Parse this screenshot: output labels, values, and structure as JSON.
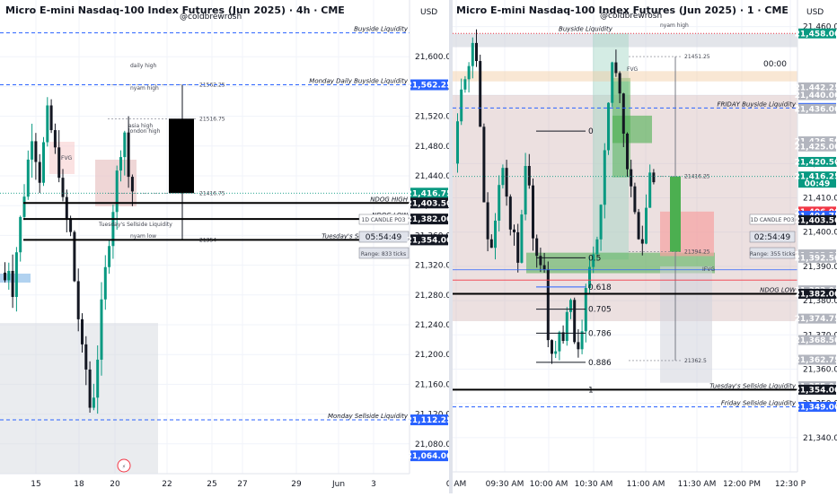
{
  "watermark": "@coldbrewrosh",
  "chart_data": [
    {
      "type": "candlestick",
      "title": "Micro E-mini Nasdaq-100 Index Futures (Jun 2025) · 4h · CME",
      "currency_label": "USD",
      "ylim": [
        21040,
        21640
      ],
      "y_ticks": [
        21600,
        21560,
        21520,
        21480,
        21440,
        21400,
        21360,
        21320,
        21280,
        21240,
        21200,
        21160,
        21120,
        21080
      ],
      "y_tick_labels": [
        "21,600.00",
        "21,560.00",
        "21,520.00",
        "21,480.00",
        "21,440.00",
        "21,400.00",
        "21,360.00",
        "21,320.00",
        "21,280.00",
        "21,240.00",
        "21,200.00",
        "21,160.00",
        "21,120.00",
        "21,080.00"
      ],
      "x_ticks": [
        "15",
        "18",
        "20",
        "22",
        "25",
        "27",
        "29",
        "Jun",
        "3"
      ],
      "price_tags": [
        {
          "value": 21562.25,
          "label": "21,562.25",
          "color": "#2962ff"
        },
        {
          "value": 21416.75,
          "label": "21,416.75",
          "sub": "02:54:49",
          "color": "#089981"
        },
        {
          "value": 21403.5,
          "label": "21,403.50",
          "color": "#131722"
        },
        {
          "value": 21382.0,
          "label": "21,382.00",
          "color": "#131722"
        },
        {
          "value": 21354.0,
          "label": "21,354.00",
          "color": "#131722"
        },
        {
          "value": 21112.25,
          "label": "21,112.25",
          "color": "#2962ff"
        },
        {
          "value": 21064.0,
          "label": "21,064.00",
          "color": "#2962ff"
        }
      ],
      "levels": [
        {
          "value": 21632,
          "label": "Buyside Liquidity",
          "style": "dashed",
          "color": "#2962ff"
        },
        {
          "value": 21562.25,
          "label": "Monday Daily Buyside Liquidity",
          "style": "dashed",
          "color": "#2962ff"
        },
        {
          "value": 21403.5,
          "label": "NDOG HIGH",
          "style": "solid",
          "color": "#000000"
        },
        {
          "value": 21382.0,
          "label": "NDOG LOW",
          "style": "solid",
          "color": "#000000"
        },
        {
          "value": 21354.0,
          "label": "Tuesday's Sellside Liquidity",
          "style": "solid",
          "color": "#000000"
        },
        {
          "value": 21112.25,
          "label": "Monday Sellside Liquidity",
          "style": "dashed",
          "color": "#2962ff"
        }
      ],
      "annotations": {
        "candle_box_title": "1D CANDLE PO3",
        "candle_box_timer": "05:54:49",
        "candle_box_range": "Range: 833 ticks",
        "po3_levels": [
          "21562.25",
          "21516.75",
          "21416.75",
          "21354"
        ],
        "small_labels": [
          "daily high",
          "nyam high",
          "asia high",
          "london high",
          "Tuesday's Sellside Liquidity",
          "nyam low",
          "FVG"
        ]
      }
    },
    {
      "type": "candlestick",
      "title": "Micro E-mini Nasdaq-100 Index Futures (Jun 2025) · 1 · CME",
      "currency_label": "USD",
      "ylim": [
        21330,
        21462
      ],
      "y_ticks": [
        21460,
        21440,
        21420,
        21410,
        21400,
        21390,
        21380,
        21370,
        21360,
        21350,
        21340
      ],
      "x_ticks": [
        "0 AM",
        "09:30 AM",
        "10:00 AM",
        "10:30 AM",
        "11:00 AM",
        "11:30 AM",
        "12:00 PM",
        "12:30 P"
      ],
      "price_tags": [
        {
          "value": 21458.0,
          "label": "21,458.00",
          "color": "#089981"
        },
        {
          "value": 21442.25,
          "label": "21,442.25",
          "color": "#b2b5be"
        },
        {
          "value": 21440.0,
          "label": "21,440.00",
          "color": "#b2b5be"
        },
        {
          "value": 21436.25,
          "label": "21,436.25",
          "color": "#2962ff"
        },
        {
          "value": 21436.0,
          "label": "21,436.00",
          "color": "#b2b5be"
        },
        {
          "value": 21426.5,
          "label": "21,426.50",
          "color": "#b2b5be"
        },
        {
          "value": 21425.0,
          "label": "21,425.00",
          "color": "#b2b5be"
        },
        {
          "value": 21420.5,
          "label": "21,420.50",
          "color": "#089981"
        },
        {
          "value": 21416.25,
          "label": "21,416.25",
          "sub": "00:49",
          "color": "#089981"
        },
        {
          "value": 21406.0,
          "label": "21,406.00",
          "color": "#f23645"
        },
        {
          "value": 21404.75,
          "label": "21,404.75",
          "color": "#2962ff"
        },
        {
          "value": 21403.5,
          "label": "21,403.50",
          "color": "#131722"
        },
        {
          "value": 21393.5,
          "label": "21,393.50",
          "color": "#b2b5be"
        },
        {
          "value": 21393.25,
          "label": "21,393.25",
          "color": "#b2b5be"
        },
        {
          "value": 21392.5,
          "label": "21,392.50",
          "color": "#b2b5be"
        },
        {
          "value": 21383.0,
          "label": "21,383.00",
          "color": "#b2b5be"
        },
        {
          "value": 21382.0,
          "label": "21,382.00",
          "color": "#131722"
        },
        {
          "value": 21374.75,
          "label": "21,374.75",
          "color": "#b2b5be"
        },
        {
          "value": 21368.5,
          "label": "21,368.50",
          "color": "#b2b5be"
        },
        {
          "value": 21362.75,
          "label": "21,362.75",
          "color": "#b2b5be"
        },
        {
          "value": 21355.0,
          "label": "21,355.00",
          "color": "#b2b5be"
        },
        {
          "value": 21354.0,
          "label": "21,354.00",
          "color": "#131722"
        },
        {
          "value": 21349.0,
          "label": "21,349.00",
          "color": "#2962ff"
        }
      ],
      "levels": [
        {
          "value": 21458,
          "label": "Buyside Liquidity",
          "style": "dotted",
          "color": "#f23645"
        },
        {
          "value": 21436.25,
          "label": "FRIDAY Buyside Liquidity",
          "style": "dashed",
          "color": "#2962ff"
        },
        {
          "value": 21382.0,
          "label": "NDOG LOW",
          "style": "solid",
          "color": "#000000"
        },
        {
          "value": 21354.0,
          "label": "Tuesday's Sellside Liquidity",
          "style": "solid",
          "color": "#000000"
        },
        {
          "value": 21349.0,
          "label": "Friday Sellside Liquidity",
          "style": "dashed",
          "color": "#2962ff"
        }
      ],
      "fib_levels": [
        {
          "value": 21429.5,
          "label": "0"
        },
        {
          "value": 21392.5,
          "label": "0.5"
        },
        {
          "value": 21384.0,
          "label": "0.618"
        },
        {
          "value": 21377.5,
          "label": "0.705"
        },
        {
          "value": 21370.5,
          "label": "0.786"
        },
        {
          "value": 21362.0,
          "label": "0.886"
        },
        {
          "value": 21354.0,
          "label": "1"
        }
      ],
      "annotations": {
        "candle_box_title": "1D CANDLE PO3",
        "candle_box_timer": "02:54:49",
        "candle_box_range": "Range: 355 ticks",
        "po3_levels": [
          "21451.25",
          "21416.25",
          "21394.25",
          "21362.5"
        ],
        "clock": "00:00",
        "small_labels": [
          "nyam high",
          "FVG",
          "IFVG"
        ]
      }
    }
  ]
}
